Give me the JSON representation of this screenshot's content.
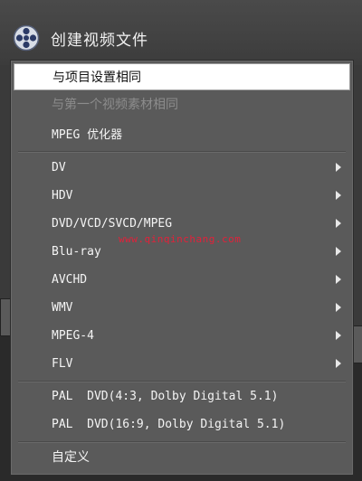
{
  "header": {
    "title": "创建视频文件",
    "icon": "film-reel-icon"
  },
  "menu": {
    "items": [
      {
        "label": "与项目设置相同",
        "state": "selected",
        "submenu": false
      },
      {
        "label": "与第一个视频素材相同",
        "state": "disabled",
        "submenu": false
      },
      {
        "label": "MPEG 优化器",
        "state": "normal",
        "submenu": false
      },
      {
        "label": "DV",
        "state": "normal",
        "submenu": true
      },
      {
        "label": "HDV",
        "state": "normal",
        "submenu": true
      },
      {
        "label": "DVD/VCD/SVCD/MPEG",
        "state": "normal",
        "submenu": true
      },
      {
        "label": "Blu-ray",
        "state": "normal",
        "submenu": true
      },
      {
        "label": "AVCHD",
        "state": "normal",
        "submenu": true
      },
      {
        "label": "WMV",
        "state": "normal",
        "submenu": true
      },
      {
        "label": "MPEG-4",
        "state": "normal",
        "submenu": true
      },
      {
        "label": "FLV",
        "state": "normal",
        "submenu": true
      },
      {
        "label": "PAL  DVD(4:3, Dolby Digital 5.1)",
        "state": "normal",
        "submenu": false
      },
      {
        "label": "PAL  DVD(16:9, Dolby Digital 5.1)",
        "state": "normal",
        "submenu": false
      },
      {
        "label": "自定义",
        "state": "normal",
        "submenu": false
      }
    ]
  },
  "watermark": {
    "text": "www.qinqinchang.com",
    "color": "#e2213a"
  },
  "colors": {
    "menu_bg": "#5a5a5a",
    "selected_bg": "#ffffff",
    "text": "#f4f4f4",
    "disabled_text": "#8c8c8c"
  }
}
